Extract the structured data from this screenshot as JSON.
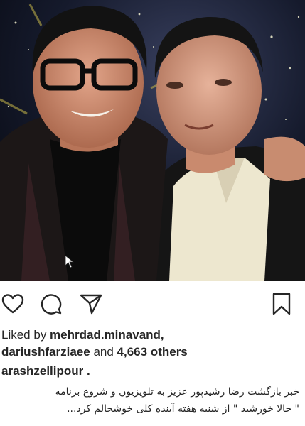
{
  "post": {
    "image_alt": "two men posing together on a TV studio set",
    "actions": {
      "like_icon": "heart-icon",
      "comment_icon": "comment-icon",
      "share_icon": "send-icon",
      "save_icon": "bookmark-icon"
    },
    "likes": {
      "prefix": "Liked by ",
      "user1": "mehrdad.minavand",
      "separator": ",",
      "user2": "dariushfarziaee",
      "middle": " and ",
      "count": "4,663 others"
    },
    "author": "arashzellipour .",
    "caption_line1": "خبر بازگشت رضا رشیدپور عزیز به تلویزیون و شروع برنامه",
    "caption_line2": "\" حالا خورشید \" از شنبه هفته آینده کلی خوشحالم کرد..."
  },
  "colors": {
    "text": "#262626",
    "background": "#ffffff"
  }
}
